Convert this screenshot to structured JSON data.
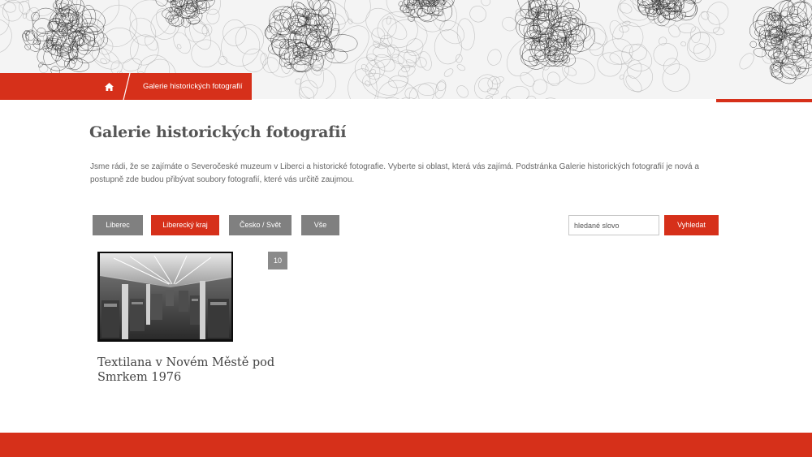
{
  "colors": {
    "accent": "#d6301a",
    "button_grey": "#808080",
    "badge_grey": "#8a8a8a",
    "title_text": "#555555"
  },
  "header": {
    "decoration": "scribble-pattern"
  },
  "breadcrumb": {
    "home_icon": "home-icon",
    "current": "Galerie historických fotografií"
  },
  "main": {
    "title": "Galerie historických fotografií",
    "intro_line1": "Jsme rádi, že se zajímáte o Severočeské muzeum v Liberci a historické fotografie. Vyberte si oblast, která vás zajímá. Podstránka Galerie historických fotografií je nová a",
    "intro_line2": "postupně zde budou přibývat soubory fotografií, které vás určitě zaujmou."
  },
  "filters": [
    {
      "label": "Liberec",
      "active": false
    },
    {
      "label": "Liberecký kraj",
      "active": true
    },
    {
      "label": "Česko / Svět",
      "active": false
    },
    {
      "label": "Vše",
      "active": false
    }
  ],
  "search": {
    "placeholder": "hledané slovo",
    "value": "",
    "button_label": "Vyhledat"
  },
  "gallery": [
    {
      "title_line1": "Textilana v Novém Městě pod",
      "title_line2": "Smrkem 1976",
      "count": "10",
      "image": "black-and-white factory hall photo"
    }
  ]
}
